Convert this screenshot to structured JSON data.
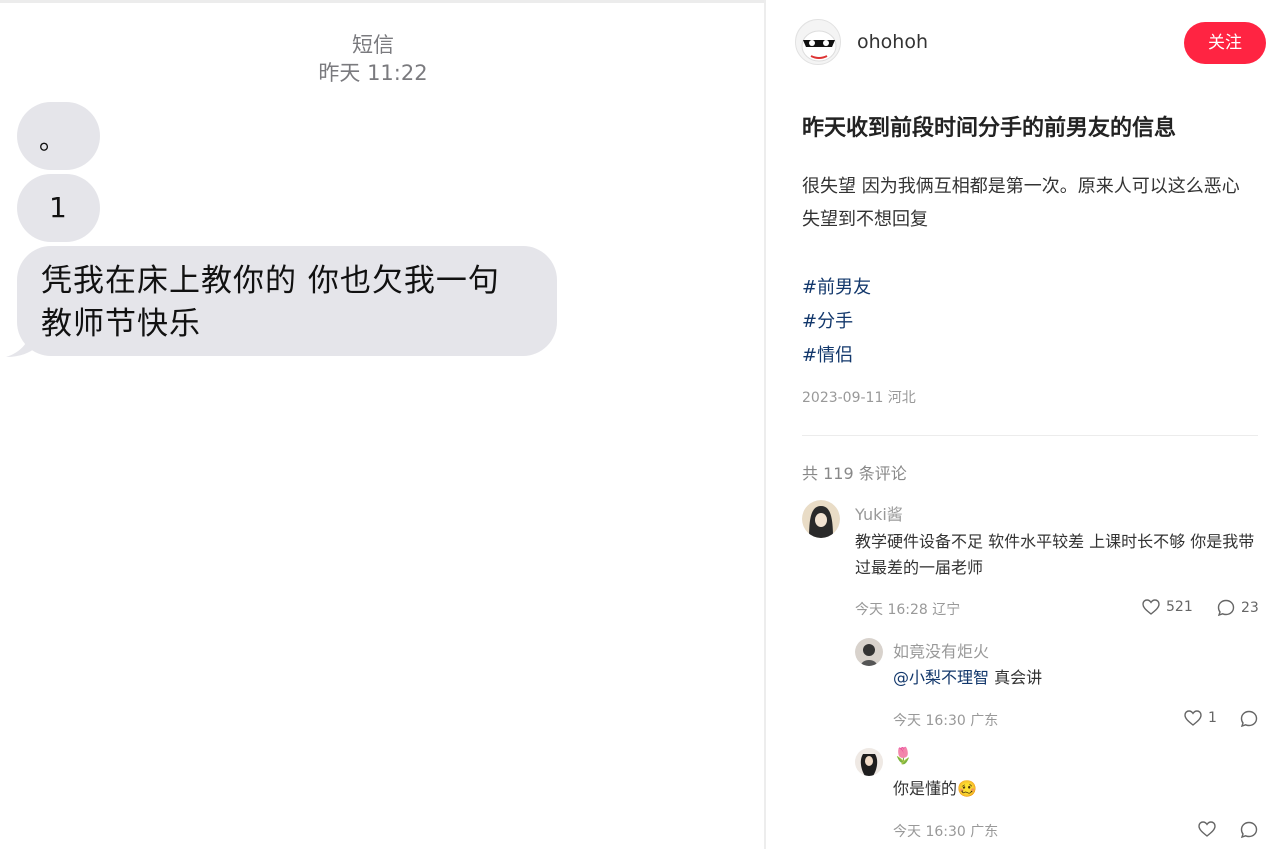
{
  "sms": {
    "app_title": "短信",
    "timestamp": "昨天 11:22",
    "messages": [
      "。",
      "1",
      "凭我在床上教你的 你也欠我一句教师节快乐"
    ]
  },
  "post": {
    "author": {
      "name": "ohohoh"
    },
    "follow_label": "关注",
    "title": "昨天收到前段时间分手的前男友的信息",
    "body": "很失望 因为我俩互相都是第一次。原来人可以这么恶心 失望到不想回复",
    "tags": [
      "#前男友",
      "#分手",
      "#情侣"
    ],
    "meta": "2023-09-11 河北",
    "comment_count_label": "共 119 条评论",
    "accent_color": "#ff2442",
    "tag_color": "#13386c"
  },
  "comments": [
    {
      "user": "Yuki酱",
      "text": "教学硬件设备不足 软件水平较差 上课时长不够 你是我带过最差的一届老师",
      "time_place": "今天 16:28 辽宁",
      "likes": "521",
      "replies": "23"
    },
    {
      "user": "如竟没有炬火",
      "mention": "@小梨不理智",
      "text": "真会讲",
      "time_place": "今天 16:30 广东",
      "likes": "1",
      "replies": ""
    },
    {
      "user": "🌷",
      "text": "你是懂的🥴",
      "time_place": "今天 16:30 广东",
      "likes": "",
      "replies": ""
    }
  ]
}
